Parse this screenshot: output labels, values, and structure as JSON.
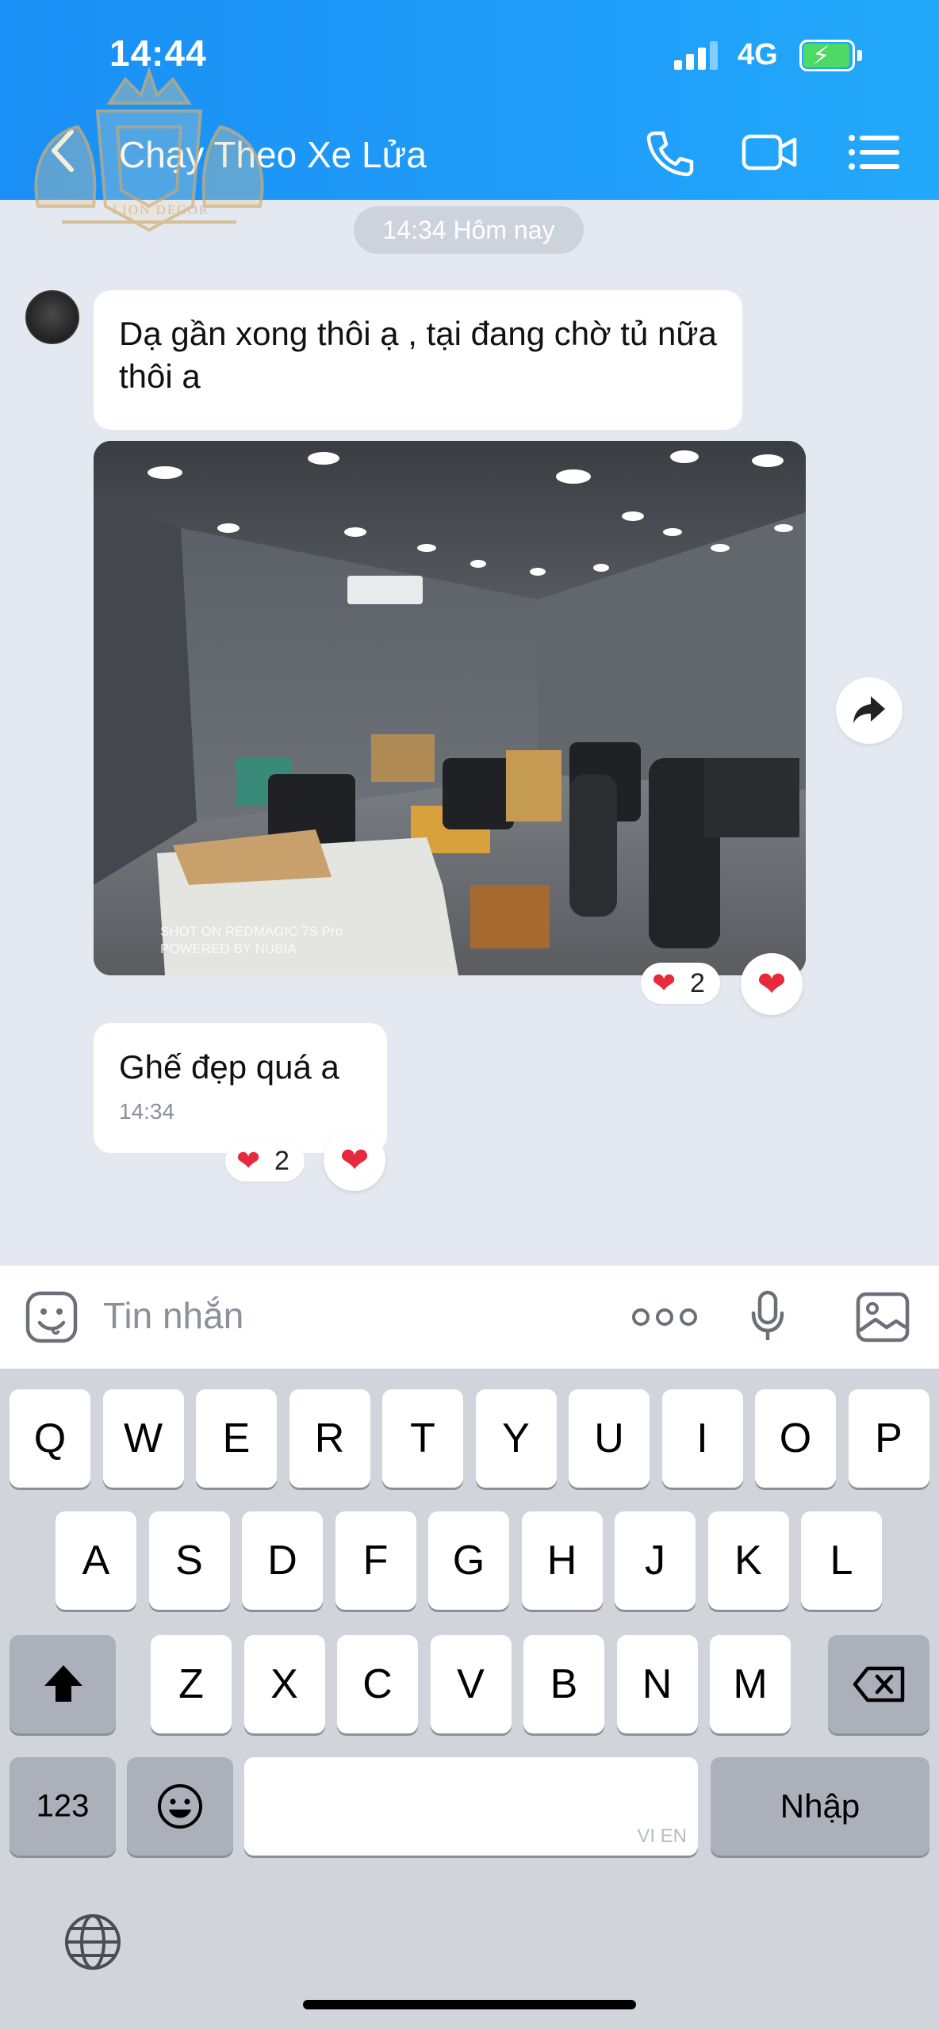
{
  "status_bar": {
    "time": "14:44",
    "network": "4G"
  },
  "header": {
    "title": "Chạy Theo Xe Lửa"
  },
  "watermark": {
    "brand": "LION DECOR"
  },
  "chat": {
    "date_divider": "14:34 Hôm nay",
    "messages": [
      {
        "text": "Dạ gần xong thôi ạ , tại đang chờ tủ nữa thôi a"
      },
      {
        "photo_caption_line1": "SHOT ON REDMAGIC 7S Pro",
        "photo_caption_line2": "POWERED BY NUBIA",
        "reaction_count": "2"
      },
      {
        "text": "Ghế đẹp quá a",
        "time": "14:34",
        "reaction_count": "2"
      }
    ]
  },
  "composer": {
    "placeholder": "Tin nhắn"
  },
  "keyboard": {
    "row1": [
      "Q",
      "W",
      "E",
      "R",
      "T",
      "Y",
      "U",
      "I",
      "O",
      "P"
    ],
    "row2": [
      "A",
      "S",
      "D",
      "F",
      "G",
      "H",
      "J",
      "K",
      "L"
    ],
    "row3": [
      "Z",
      "X",
      "C",
      "V",
      "B",
      "N",
      "M"
    ],
    "numbers_label": "123",
    "return_label": "Nhập",
    "space_hint": "VI EN"
  },
  "colors": {
    "header": "#1f9df9",
    "chat_bg": "#e4e8f0",
    "heart": "#e8283b"
  }
}
